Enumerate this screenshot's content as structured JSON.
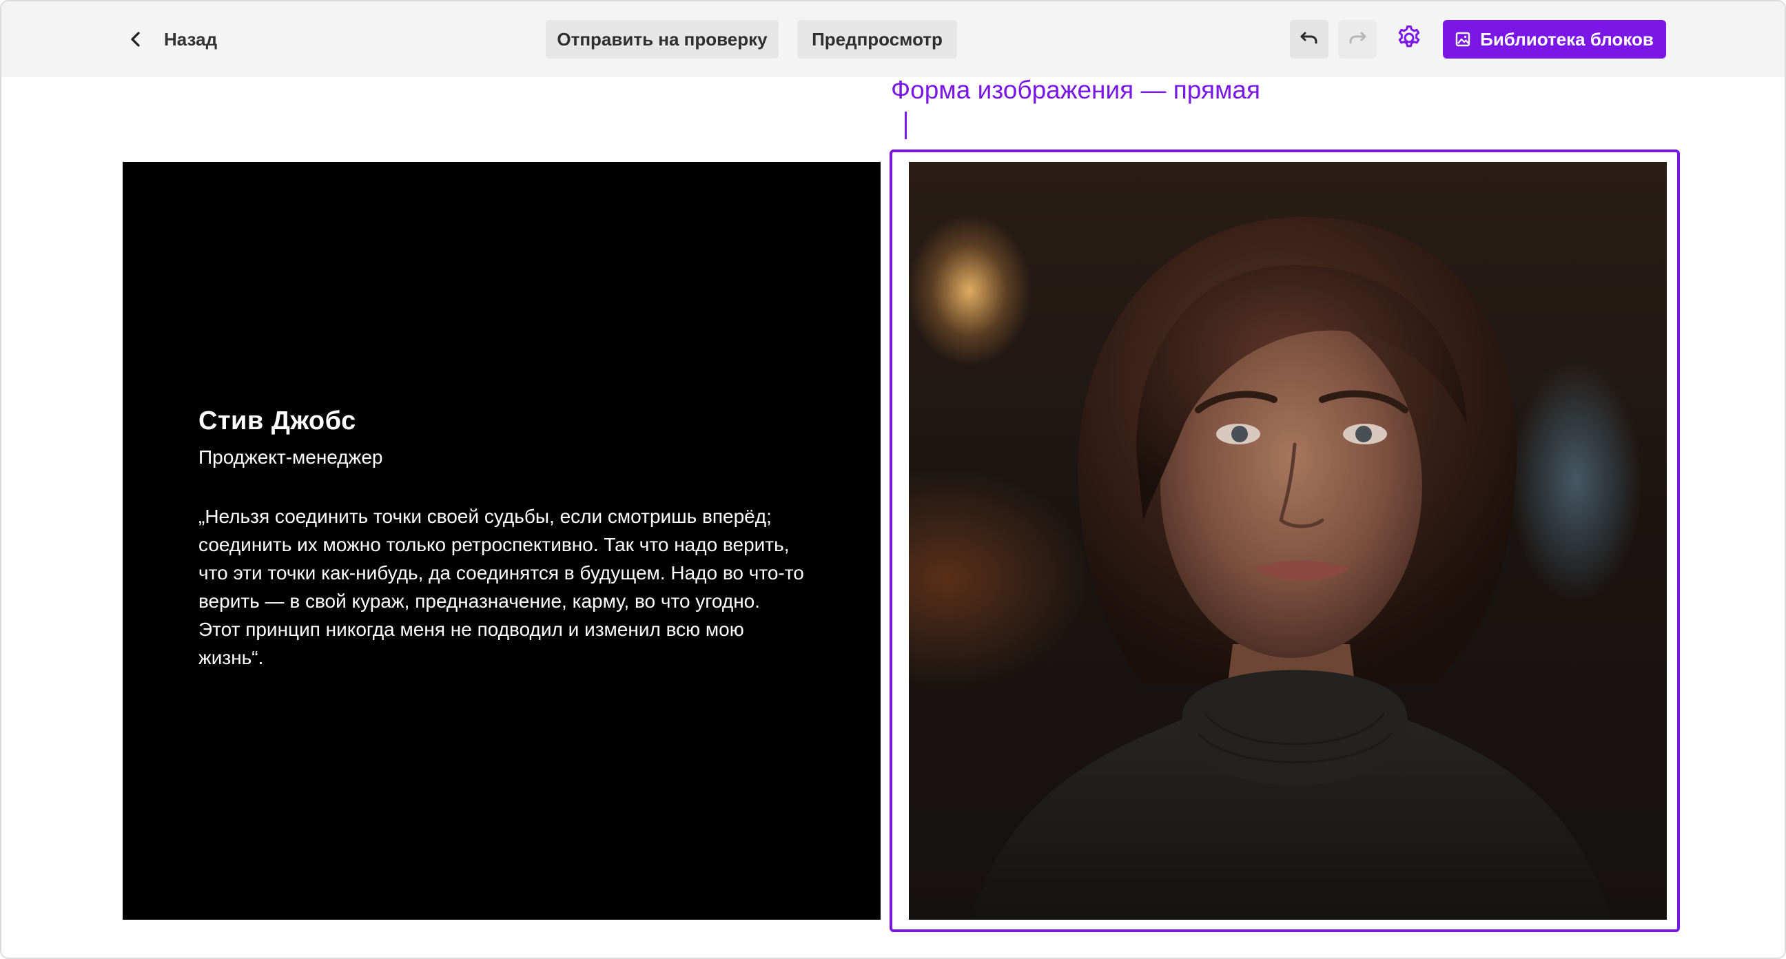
{
  "toolbar": {
    "back_label": "Назад",
    "submit_label": "Отправить на проверку",
    "preview_label": "Предпросмотр",
    "library_label": "Библиотека блоков",
    "accent_color": "#7b17e6"
  },
  "icons": {
    "back": "chevron-left-icon",
    "undo": "undo-icon",
    "redo": "redo-icon",
    "settings": "gear-icon",
    "library": "image-icon"
  },
  "annotation": {
    "text": "Форма изображения — прямая"
  },
  "block": {
    "name": "Стив Джобс",
    "role": "Проджект-менеджер",
    "quote": "„Нельзя соединить точки своей судьбы, если смотришь вперёд; соединить их можно только ретроспективно. Так что надо верить, что эти точки как-нибудь, да соединятся в будущем. Надо во что-то верить — в свой кураж, предназначение, карму, во что угодно. Этот принцип никогда меня не подводил и изменил всю мою жизнь“."
  }
}
